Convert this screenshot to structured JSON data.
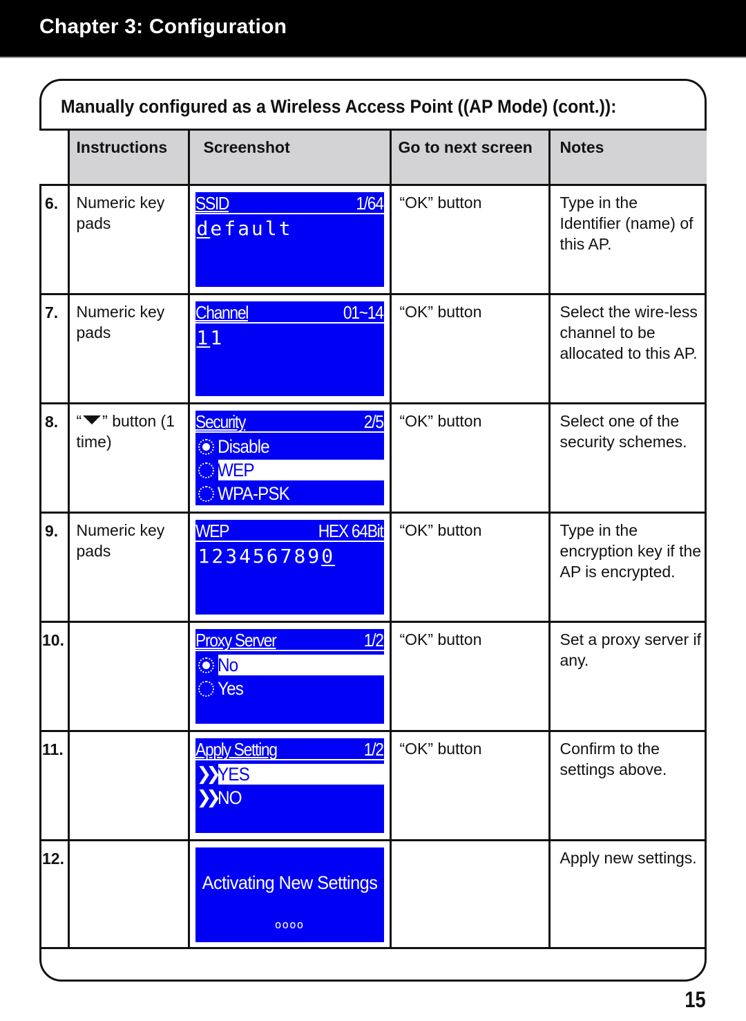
{
  "header": {
    "chapter_title": "Chapter 3: Configuration"
  },
  "section": {
    "title": "Manually configured as a Wireless Access Point ((AP Mode) (cont.)):"
  },
  "table": {
    "columns": [
      "",
      "Instructions",
      "Screenshot",
      "Go to next screen",
      "Notes"
    ],
    "rows": [
      {
        "num": "6.",
        "instructions": "Numeric key pads",
        "next": "“OK” button",
        "notes": "Type in the Identifier (name) of this AP.",
        "screen": {
          "type": "input",
          "title": "SSID",
          "right": "1/64",
          "cursor_char": "d",
          "value_rest": "efault"
        }
      },
      {
        "num": "7.",
        "instructions": "Numeric key pads",
        "next": "“OK” button",
        "notes": "Select the wire-less channel to be allocated to this AP.",
        "screen": {
          "type": "input",
          "title": "Channel",
          "right": "01~14",
          "cursor_char": "1",
          "value_rest": "1"
        }
      },
      {
        "num": "8.",
        "instructions_prefix": "“",
        "instructions_icon": "down-triangle-icon",
        "instructions_suffix": "” button (1 time)",
        "next": "“OK” button",
        "notes": "Select one of the security schemes.",
        "screen": {
          "type": "radio",
          "title": "Security",
          "right": "2/5",
          "options": [
            {
              "label": "Disable",
              "checked": true,
              "highlighted": false
            },
            {
              "label": "WEP",
              "checked": false,
              "highlighted": true
            },
            {
              "label": "WPA-PSK",
              "checked": false,
              "highlighted": false
            }
          ]
        }
      },
      {
        "num": "9.",
        "instructions": "Numeric key pads",
        "next": "“OK” button",
        "notes": "Type in the encryption key if the AP is encrypted.",
        "screen": {
          "type": "input_end",
          "title": "WEP",
          "right": "HEX 64Bit",
          "value_rest": "123456789",
          "cursor_char": "0"
        }
      },
      {
        "num": "10.",
        "instructions": "",
        "next": "“OK” button",
        "notes": "Set a proxy server if any.",
        "screen": {
          "type": "radio",
          "title": "Proxy Server",
          "right": "1/2",
          "options": [
            {
              "label": "No",
              "checked": true,
              "highlighted": true
            },
            {
              "label": "Yes",
              "checked": false,
              "highlighted": false
            }
          ]
        }
      },
      {
        "num": "11.",
        "instructions": "",
        "next": "“OK” button",
        "notes": "Confirm to the settings above.",
        "screen": {
          "type": "chevron",
          "title": "Apply Setting",
          "right": "1/2",
          "options": [
            {
              "label": "YES",
              "highlighted": true
            },
            {
              "label": "NO",
              "highlighted": false
            }
          ]
        }
      },
      {
        "num": "12.",
        "instructions": "",
        "next": "",
        "notes": "Apply new settings.",
        "screen": {
          "type": "message",
          "message": "Activating New Settings",
          "progress_dots": "oooo"
        }
      }
    ]
  },
  "colors": {
    "lcd_background": "#0000f4",
    "lcd_text": "#ffffff",
    "header_fill": "#d3d3d5",
    "chapter_bar": "#000000"
  },
  "footer": {
    "page_number": "15"
  }
}
